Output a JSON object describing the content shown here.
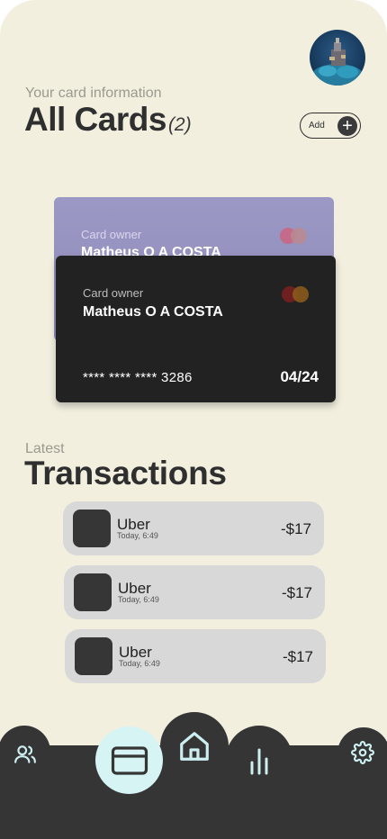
{
  "header": {
    "subtitle": "Your card information",
    "title": "All Cards",
    "count": "(2)",
    "add_label": "Add",
    "add_plus": "+"
  },
  "cards": [
    {
      "owner_label": "Card owner",
      "owner_name": "Matheus O A COSTA",
      "color": "#9c98c4"
    },
    {
      "owner_label": "Card owner",
      "owner_name": "Matheus O A COSTA",
      "number": "**** **** **** 3286",
      "expiry": "04/24",
      "color": "#222222"
    }
  ],
  "transactions": {
    "eyebrow": "Latest",
    "title": "Transactions",
    "items": [
      {
        "name": "Uber",
        "time": "Today, 6:49",
        "amount": "-$17"
      },
      {
        "name": "Uber",
        "time": "Today, 6:49",
        "amount": "-$17"
      },
      {
        "name": "Uber",
        "time": "Today, 6:49",
        "amount": "-$17"
      }
    ]
  },
  "nav": {
    "items": [
      {
        "icon": "users-icon"
      },
      {
        "icon": "credit-card-icon",
        "active": true
      },
      {
        "icon": "home-icon"
      },
      {
        "icon": "bar-chart-icon"
      },
      {
        "icon": "gear-icon"
      }
    ],
    "icon_color": "#cdeff0",
    "active_bg": "#d6f4f3"
  },
  "colors": {
    "background": "#f2efdf",
    "text_dark": "#2f2f2f",
    "muted": "#9a9a8e",
    "transaction_bg": "#d8d8d8",
    "navbar": "#353535",
    "mastercard_red": "#6e2020",
    "mastercard_orange": "#8a5a1c"
  }
}
